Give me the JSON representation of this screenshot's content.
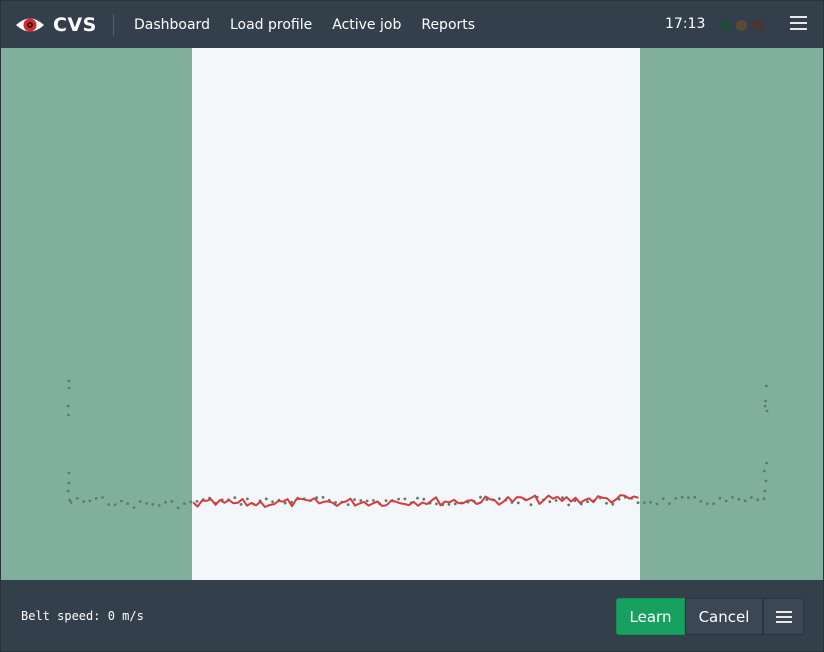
{
  "app": {
    "name": "CVS"
  },
  "nav": {
    "items": [
      "Dashboard",
      "Load profile",
      "Active job",
      "Reports"
    ]
  },
  "status": {
    "time": "17:13",
    "lights": [
      "#1f4a3c",
      "#5a4a35",
      "#4a3535"
    ]
  },
  "colors": {
    "background": "#343f4c",
    "plot_side": "#80b09d",
    "plot_center": "#f3f7fa",
    "profile_line": "#d63c3c",
    "profile_points": "#5b7a72",
    "learn_button": "#18a061"
  },
  "icons": {
    "logo": "eye-logo-icon",
    "menu": "hamburger-menu-icon",
    "footer_menu": "hamburger-menu-icon"
  },
  "footer": {
    "belt_speed": "Belt speed: 0 m/s",
    "learn_label": "Learn",
    "cancel_label": "Cancel"
  }
}
